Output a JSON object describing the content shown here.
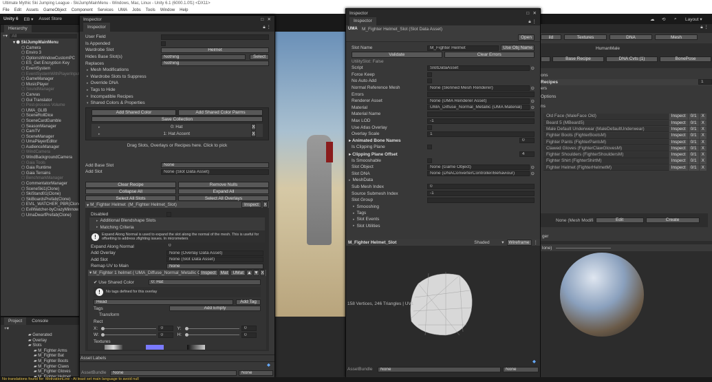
{
  "window": {
    "title": "Ultimate Mythic Ski Jumping League - SkiJumpMainMenu - Windows, Mac, Linux - Unity 6.1 (6000.1.0f1) <DX11>"
  },
  "menu": [
    "File",
    "Edit",
    "Assets",
    "GameObject",
    "Component",
    "Services",
    "UMA",
    "Jobs",
    "Tools",
    "Window",
    "Help"
  ],
  "toolbar": {
    "unity": "Unity 6",
    "account": "EB ▾",
    "store": "Asset Store",
    "layout": "Layout ▾"
  },
  "hierarchy": {
    "tab": "Hierarchy",
    "search": "All",
    "root": "SkiJumpMainMenu",
    "items": [
      {
        "n": "Camera"
      },
      {
        "n": "Enviro 3"
      },
      {
        "n": "OptionsWindowCustomPC"
      },
      {
        "n": "ES_Get Encryption Key"
      },
      {
        "n": "EventSystem"
      },
      {
        "n": "EventSystemWithPlayerInput",
        "d": true
      },
      {
        "n": "GameManager"
      },
      {
        "n": "MusicPlayer"
      },
      {
        "n": "SoundManager",
        "d": true
      },
      {
        "n": "Canvas"
      },
      {
        "n": "Gui Translator"
      },
      {
        "n": "Post-process Volume",
        "d": true
      },
      {
        "n": "UMA_GLIB"
      },
      {
        "n": "SceneRollDice"
      },
      {
        "n": "SceneCardGamble"
      },
      {
        "n": "SeasonManager"
      },
      {
        "n": "CamTV"
      },
      {
        "n": "SceneManager"
      },
      {
        "n": "UmaPlayerEditor"
      },
      {
        "n": "AudienceManager"
      },
      {
        "n": "WindCamera",
        "d": true
      },
      {
        "n": "WindBackgroundCamera"
      },
      {
        "n": "Gaia Tools",
        "d": true
      },
      {
        "n": "Gaia Runtime"
      },
      {
        "n": "Gaia Terrains"
      },
      {
        "n": "BenchmarkManager",
        "d": true
      },
      {
        "n": "CommentatorManager"
      },
      {
        "n": "SceneSki1(Clone)"
      },
      {
        "n": "SkiStand01(Clone)"
      },
      {
        "n": "SkiBoardsPrefab(Clone)"
      },
      {
        "n": "EVIL_WATCHER_PBR(Clone)"
      },
      {
        "n": "EvilWatcher-byCrazyMinnow"
      },
      {
        "n": "UmaDwarfPrefab(Clone)"
      }
    ]
  },
  "project": {
    "tab1": "Project",
    "tab2": "Console",
    "folders": [
      "Generated",
      "Overlay",
      "Slots"
    ],
    "sub": [
      "M_Fighter Arms",
      "M_Fighter Bat",
      "M_Fighter Boots",
      "M_Fighter Claws",
      "M_Fighter Gloves",
      "M_Fighter Helmet"
    ]
  },
  "insp1": {
    "title": "Inspector",
    "tab": "Inspector",
    "user_field": "User Field",
    "is_appended": "Is Appended",
    "wardrobe_slot": "Wardrobe Slot",
    "wardrobe_val": "Helmet",
    "hides": "Hides Base Slot(s)",
    "hides_val": "Nothing",
    "select": "Select",
    "replaces": "Replaces",
    "replaces_val": "Nothing",
    "folds": [
      "Mesh Modifications",
      "Wardrobe Slots to Suppress",
      "Override DNA",
      "Tags to Hide",
      "Incompatible Recipes"
    ],
    "shared": "Shared Colors & Properties",
    "add_shared_color": "Add Shared Color",
    "add_shared_parms": "Add Shared Color Parms",
    "save_collection": "Save Collection",
    "colors": [
      "0: Hat",
      "1: Hat Accent"
    ],
    "x": "X",
    "drag": "Drag Slots, Overlays or Recipes here. Click to pick",
    "add_base_slot": "Add Base Slot",
    "add_base_val": "None",
    "add_slot": "Add Slot",
    "add_slot_val": "None (Slot Data Asset)",
    "clear": "Clear Recipe",
    "remove_nulls": "Remove Nulls",
    "collapse": "Collapse All",
    "expand": "Expand All",
    "sel_slots": "Select All Slots",
    "sel_overlays": "Select All Overlays",
    "slot_header": "M_Fighter Helmet",
    "slot_asset": "(M_Fighter Helmet_Slot)",
    "inspect": "Inspect",
    "disabled": "Disabled",
    "blend": "Additional Blendshape Slots",
    "matching": "Matching Criteria",
    "help": "Expand Along Normal is used to expand the slot along the normal of the mesh. This is useful for offsetting to address zfighting issues. In micrometers",
    "expand_normal": "Expand Along Normal",
    "expand_val": "0",
    "add_overlay": "Add Overlay",
    "add_overlay_val": "None (Overlay Data Asset)",
    "add_slot2": "Add Slot",
    "add_slot2_val": "None (Slot Data Asset)",
    "remap": "Remap UV to Main",
    "remap_val": "None",
    "overlay_header": "M_Fighter 1 helmet ( UMA_Diffuse_Normal_Metallic C",
    "mat": "Mat",
    "umat": "UMat",
    "use_shared": "Use Shared Color",
    "use_shared_val": "0: Hat",
    "no_tags": "No tags defined for this overlay",
    "head": "Head",
    "add_tag": "Add Tag",
    "tags": "Tags",
    "add_empty": "Add Empty",
    "transform": "Transform",
    "rect": "Rect",
    "x_l": "X:",
    "y_l": "Y:",
    "w_l": "W:",
    "h_l": "H:",
    "zero": "0",
    "textures": "Textures",
    "asset_labels": "Asset Labels",
    "asset_bundle": "AssetBundle",
    "none": "None"
  },
  "insp2": {
    "title": "Inspector",
    "tab": "Inspector",
    "header": "M_Fighter Helmet_Slot (Slot Data Asset)",
    "open": "Open",
    "slot_name": "Slot Name",
    "slot_name_val": "M_Fighter Helmet",
    "use_obj": "Use Obj Name",
    "validate": "Validate",
    "clear_errors": "Clear Errors",
    "utility": "UtilitySlot: False",
    "rows": [
      {
        "l": "Script",
        "v": "SlotDataAsset",
        "t": "obj"
      },
      {
        "l": "Force Keep",
        "t": "chk"
      },
      {
        "l": "No Auto Add",
        "t": "chk"
      },
      {
        "l": "Normal Reference Mesh",
        "v": "None (Skinned Mesh Renderer)",
        "t": "obj"
      },
      {
        "l": "Errors",
        "v": "",
        "t": "txt"
      },
      {
        "l": "Renderer Asset",
        "v": "None (UMA Renderer Asset)",
        "t": "obj"
      },
      {
        "l": "Material",
        "v": "UMA_Diffuse_Normal_Metallic (UMA Material)",
        "t": "obj"
      },
      {
        "l": "Material Name",
        "v": "",
        "t": "txt"
      },
      {
        "l": "Max LOD",
        "v": "-1",
        "t": "txt"
      },
      {
        "l": "Use Atlas Overlay",
        "t": "chk"
      },
      {
        "l": "Overlay Scale",
        "v": "1",
        "t": "txt"
      }
    ],
    "anim": "Animated Bone Names",
    "anim_val": "0",
    "clip": "Is Clipping Plane",
    "clip_off": "Clipping Plane Offset",
    "clip_off_val": "4",
    "smoosh": "Is Smooshable",
    "rows2": [
      {
        "l": "Slot Object",
        "v": "None (Game Object)",
        "t": "obj"
      },
      {
        "l": "Slot DNA",
        "v": "None (DNAConverterController/Behaviour)",
        "t": "obj"
      }
    ],
    "meshdata": "MeshData",
    "rows3": [
      {
        "l": "Sub Mesh Index",
        "v": "0"
      },
      {
        "l": "Source Submesh Index",
        "v": "-1"
      },
      {
        "l": "Slot Group",
        "v": ""
      }
    ],
    "folds": [
      "Smooshing",
      "Tags",
      "Slot Events",
      "Slot Utilities"
    ],
    "preview_title": "M_Fighter Helmet_Slot",
    "shaded": "Shaded",
    "wireframe": "Wireframe",
    "stats": "158 Vertices, 246 Triangles | UV1",
    "asset_bundle": "AssetBundle",
    "none": "None"
  },
  "right": {
    "tabs": [
      "ild",
      "Textures",
      "DNA",
      "Mesh"
    ],
    "race": "HumanMale",
    "btns": [
      "Base Recipe",
      "DNA Cvts (1)",
      "BonePose"
    ],
    "ons": "ons",
    "recipes": "Recipes",
    "recipes_val": "1",
    "ers": "ers",
    "options": "Options",
    "ns": "ns",
    "items": [
      "Old Face (MaleFace Old)",
      "Beard 5 (MBeard5)",
      "Male Default Underwear (MaleDefaultUnderwear)",
      "Fighter Boots (FighterBootsM)",
      "Fighter Pants (FighterPantsM)",
      "Clawed Gloves (FighterClawGlovesM)",
      "Fighter Shoulders (FighterShouldersM)",
      "Fighter Shirt (FighterShirtM)",
      "Fighter Helmet (FighterHelmetM)"
    ],
    "inspect": "Inspect",
    "count": "0/1",
    "x": "X",
    "mesh_mod": "None (Mesh Modifi",
    "edit": "Edit",
    "create": "Create",
    "ger": "ger",
    "lone": "lone)"
  },
  "status": "No translations found for: MotivationLine - At least set main language to avoid null"
}
